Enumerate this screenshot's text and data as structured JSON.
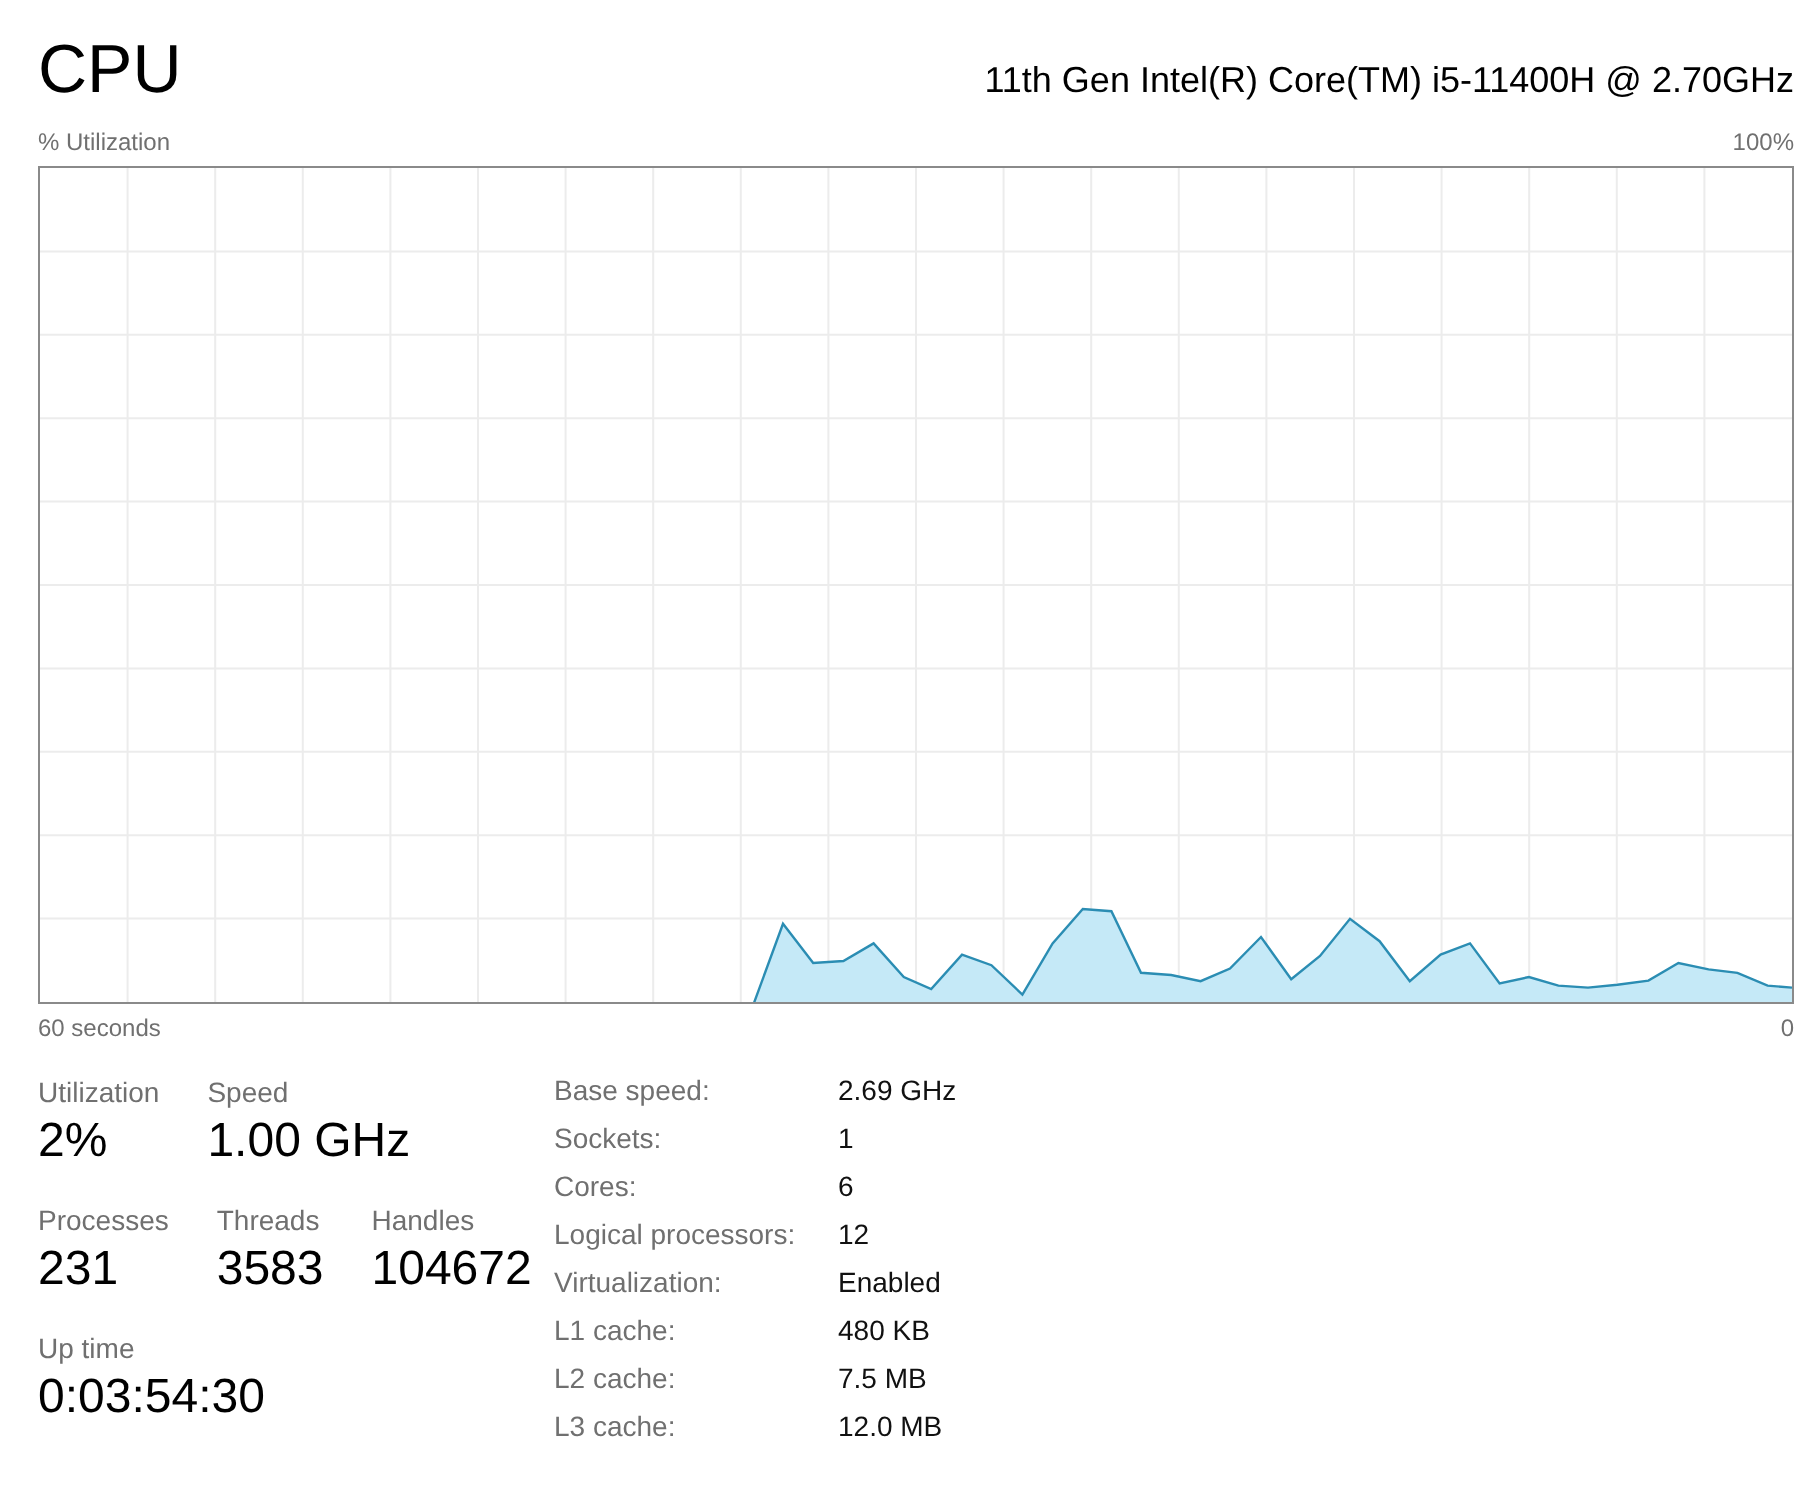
{
  "header": {
    "title": "CPU",
    "processor_name": "11th Gen Intel(R) Core(TM) i5-11400H @ 2.70GHz"
  },
  "graph": {
    "y_label": "% Utilization",
    "y_max_label": "100%",
    "x_start_label": "60 seconds",
    "x_end_label": "0"
  },
  "stats": [
    {
      "items": [
        {
          "label": "Utilization",
          "value": "2%"
        },
        {
          "label": "Speed",
          "value": "1.00 GHz"
        }
      ]
    },
    {
      "items": [
        {
          "label": "Processes",
          "value": "231"
        },
        {
          "label": "Threads",
          "value": "3583"
        },
        {
          "label": "Handles",
          "value": "104672"
        }
      ]
    },
    {
      "items": [
        {
          "label": "Up time",
          "value": "0:03:54:30"
        }
      ]
    }
  ],
  "details": [
    {
      "label": "Base speed:",
      "value": "2.69 GHz"
    },
    {
      "label": "Sockets:",
      "value": "1"
    },
    {
      "label": "Cores:",
      "value": "6"
    },
    {
      "label": "Logical processors:",
      "value": "12"
    },
    {
      "label": "Virtualization:",
      "value": "Enabled"
    },
    {
      "label": "L1 cache:",
      "value": "480 KB"
    },
    {
      "label": "L2 cache:",
      "value": "7.5 MB"
    },
    {
      "label": "L3 cache:",
      "value": "12.0 MB"
    }
  ]
}
